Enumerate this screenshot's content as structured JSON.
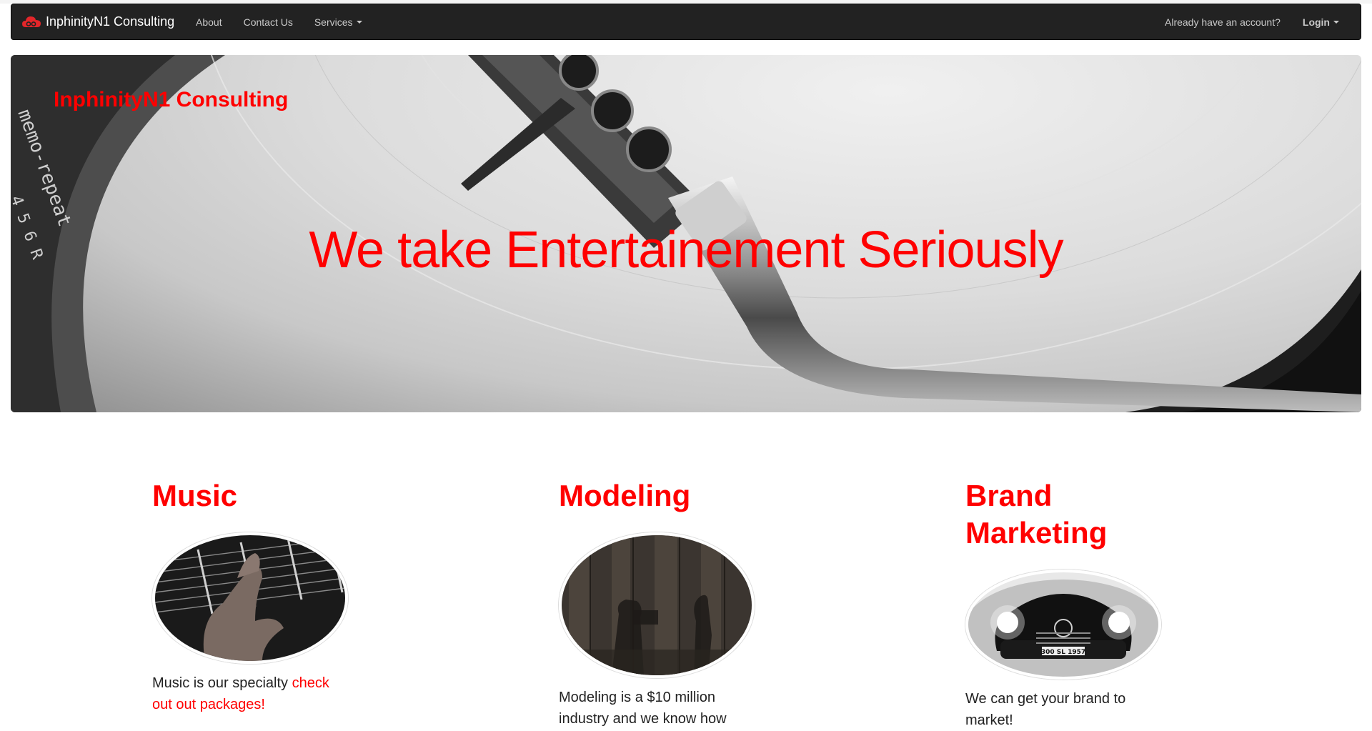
{
  "navbar": {
    "brand": "InphinityN1 Consulting",
    "brand_icon": "cloud-logo-icon",
    "links": [
      "About",
      "Contact Us",
      "Services"
    ],
    "account_prompt": "Already have an account?",
    "login_label": "Login"
  },
  "hero": {
    "brand": "InphinityN1 Consulting",
    "tagline": "We take Entertainement Seriously",
    "turntable_label": "memo-repeat",
    "turntable_numbers": "4  5  6  R"
  },
  "sections": [
    {
      "title": "Music",
      "text": "Music is our specialty ",
      "link": "check out out packages!"
    },
    {
      "title": "Modeling",
      "text": "Modeling is a $10 million industry and we know how"
    },
    {
      "title": "Brand Marketing",
      "text": "We can get your brand to market!",
      "plate": "300 SL 1957"
    }
  ],
  "colors": {
    "accent": "#ff0000",
    "navbar_bg": "#222222",
    "nav_text": "#c9c9c9"
  }
}
